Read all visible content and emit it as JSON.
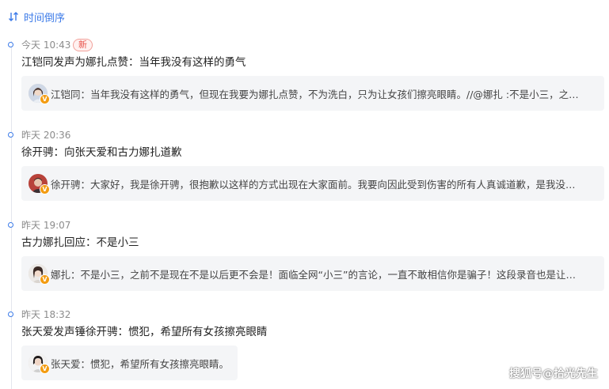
{
  "sort": {
    "label": "时间倒序",
    "icon": "sort-arrows-icon"
  },
  "entries": [
    {
      "time": "今天 10:43",
      "badge": "新",
      "headline": "江铠同发声为娜扎点赞：当年我没有这样的勇气",
      "post": {
        "author": "江铠同",
        "text": "江铠同：当年我没有这样的勇气，但现在我要为娜扎点赞，不为洗白，只为让女孩们擦亮眼睛。//@娜扎 :不是小三，之…",
        "verified": "V"
      }
    },
    {
      "time": "昨天 20:36",
      "headline": "徐开骋：向张天爱和古力娜扎道歉",
      "post": {
        "author": "徐开骋",
        "text": "徐开骋：大家好，我是徐开骋，很抱歉以这样的方式出现在大家面前。我要向因此受到伤害的所有人真诚道歉，是我没…",
        "verified": "V"
      }
    },
    {
      "time": "昨天 19:07",
      "headline": "古力娜扎回应：不是小三",
      "post": {
        "author": "娜扎",
        "text": "娜扎：不是小三，之前不是现在不是以后更不会是！面临全网“小三”的言论，一直不敢相信你是骗子！这段录音也是让…",
        "verified": "V"
      }
    },
    {
      "time": "昨天 18:32",
      "headline": "张天爱发声锤徐开骋：惯犯，希望所有女孩擦亮眼睛",
      "post": {
        "author": "张天爱",
        "text": "张天爱：惯犯，希望所有女孩擦亮眼睛。",
        "verified": "V"
      }
    }
  ],
  "watermark": "搜狐号@拾光先生"
}
